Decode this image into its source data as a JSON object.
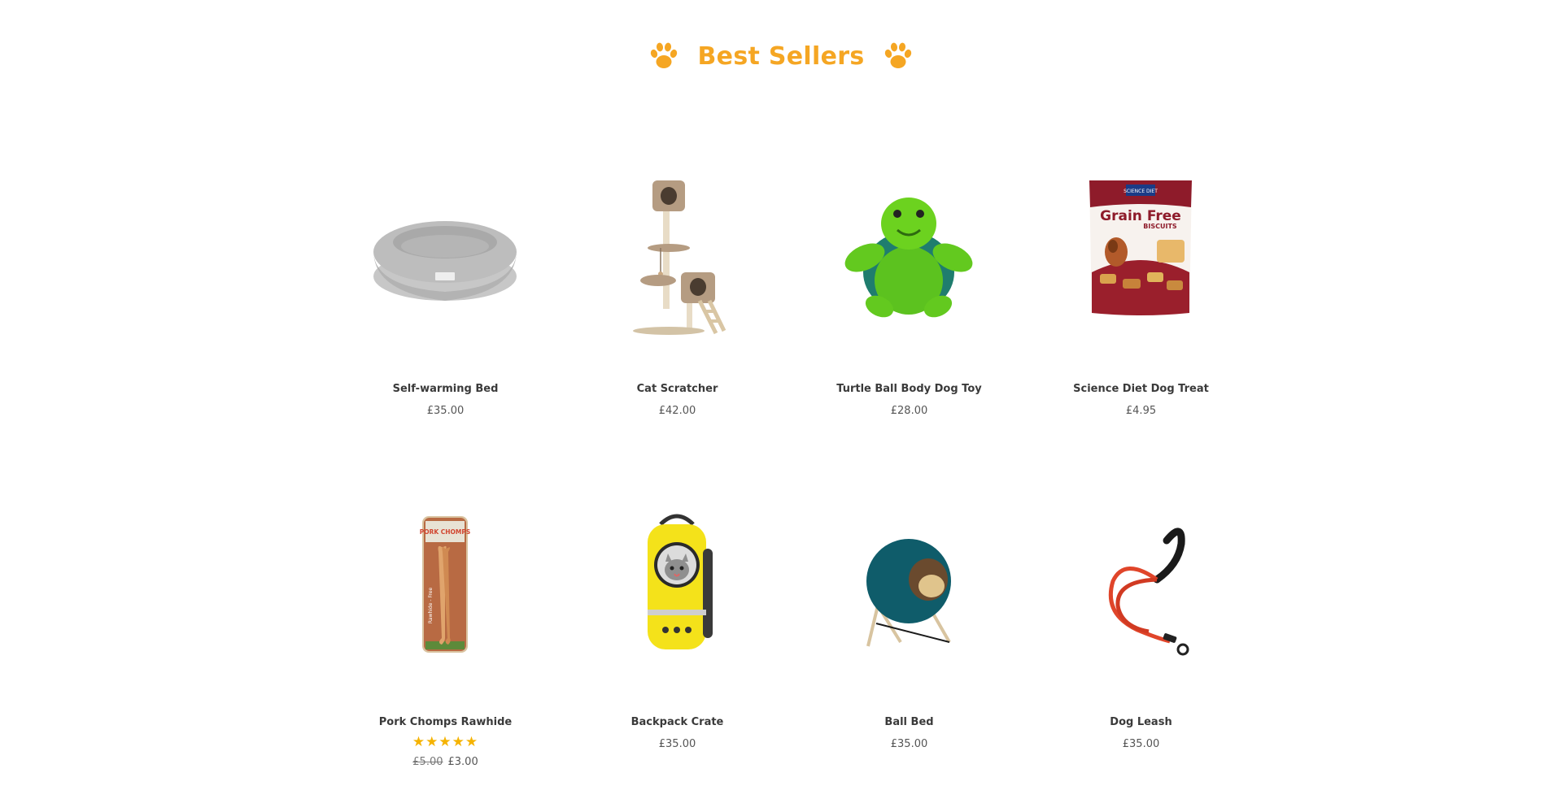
{
  "heading": {
    "title": "Best Sellers",
    "icon_left": "paw-icon",
    "icon_right": "paw-icon",
    "accent_color": "#f5a623"
  },
  "products": [
    {
      "name": "Self-warming Bed",
      "price": "£35.00",
      "image_icon": "round-pet-bed"
    },
    {
      "name": "Cat Scratcher",
      "price": "£42.00",
      "image_icon": "cat-tree"
    },
    {
      "name": "Turtle Ball Body Dog Toy",
      "price": "£28.00",
      "image_icon": "green-turtle-toy"
    },
    {
      "name": "Science Diet Dog Treat",
      "price": "£4.95",
      "image_icon": "treat-bag",
      "image_text": {
        "brand": "SCIENCE DIET",
        "line1": "Grain Free",
        "line2": "BISCUITS"
      }
    },
    {
      "name": "Pork Chomps Rawhide",
      "old_price": "£5.00",
      "price": "£3.00",
      "rating": 5,
      "rating_stars": "★★★★★",
      "image_icon": "rawhide-bone-pack",
      "image_text": {
        "brand": "PORK CHOMPS",
        "side": "Rawhide - Free"
      }
    },
    {
      "name": "Backpack Crate",
      "price": "£35.00",
      "image_icon": "bubble-backpack"
    },
    {
      "name": "Ball Bed",
      "price": "£35.00",
      "image_icon": "ball-pet-bed"
    },
    {
      "name": "Dog Leash",
      "price": "£35.00",
      "image_icon": "red-rope-leash"
    }
  ]
}
